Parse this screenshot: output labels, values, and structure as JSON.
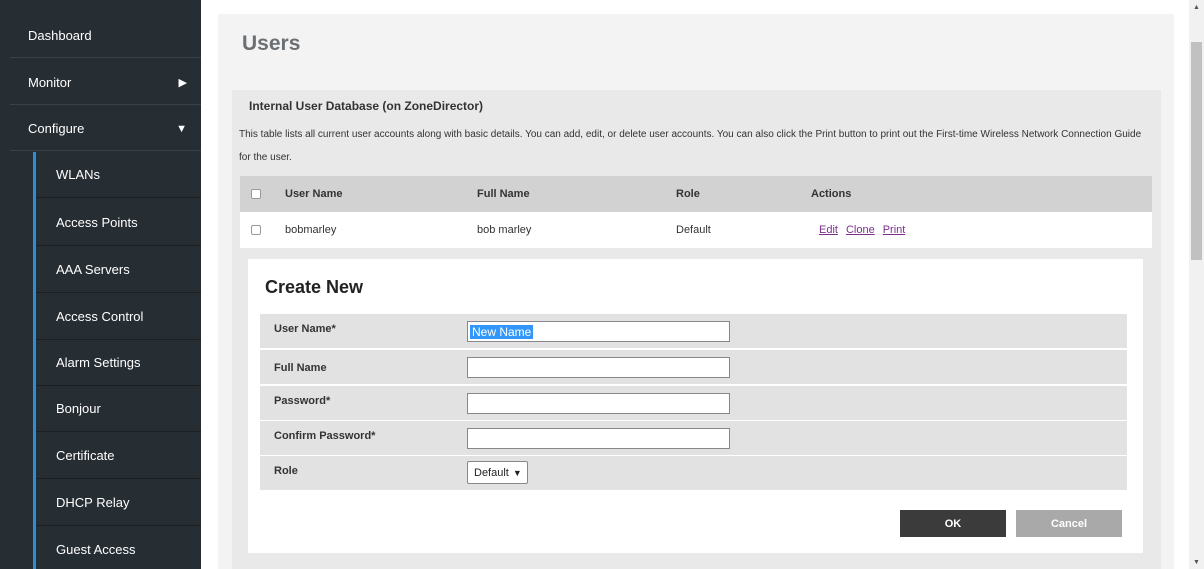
{
  "sidebar": {
    "top_items": [
      {
        "label": "Dashboard"
      },
      {
        "label": "Monitor",
        "arrow": "▶"
      },
      {
        "label": "Configure",
        "arrow": "▼"
      }
    ],
    "sub_items": [
      {
        "label": "WLANs"
      },
      {
        "label": "Access Points"
      },
      {
        "label": "AAA Servers"
      },
      {
        "label": "Access Control"
      },
      {
        "label": "Alarm Settings"
      },
      {
        "label": "Bonjour"
      },
      {
        "label": "Certificate"
      },
      {
        "label": "DHCP Relay"
      },
      {
        "label": "Guest Access"
      }
    ]
  },
  "main": {
    "title": "Users",
    "section_title": "Internal User Database (on ZoneDirector)",
    "description": "This table lists all current user accounts along with basic details. You can add, edit, or delete user accounts. You can also click the Print button to print out the First-time Wireless Network Connection Guide for the user.",
    "table": {
      "headers": [
        "User Name",
        "Full Name",
        "Role",
        "Actions"
      ],
      "rows": [
        {
          "user_name": "bobmarley",
          "full_name": "bob marley",
          "role": "Default",
          "actions": [
            "Edit",
            "Clone",
            "Print"
          ]
        }
      ]
    },
    "create_new": {
      "title": "Create New",
      "fields": {
        "user_name": {
          "label": "User Name*",
          "value": "New Name"
        },
        "full_name": {
          "label": "Full Name",
          "value": ""
        },
        "password": {
          "label": "Password*",
          "value": ""
        },
        "confirm_password": {
          "label": "Confirm Password*",
          "value": ""
        },
        "role": {
          "label": "Role",
          "value": "Default",
          "caret": "▼"
        }
      },
      "ok_label": "OK",
      "cancel_label": "Cancel"
    }
  },
  "scrollbar": {
    "up": "▲",
    "down": "▼"
  },
  "colors": {
    "sidebar_bg": "#262d33",
    "accent_bar": "#2a8fd8",
    "link": "#7b2f8b",
    "ok_button": "#3b3b3b",
    "cancel_button": "#a9a9a9",
    "selection": "#3297fd"
  }
}
